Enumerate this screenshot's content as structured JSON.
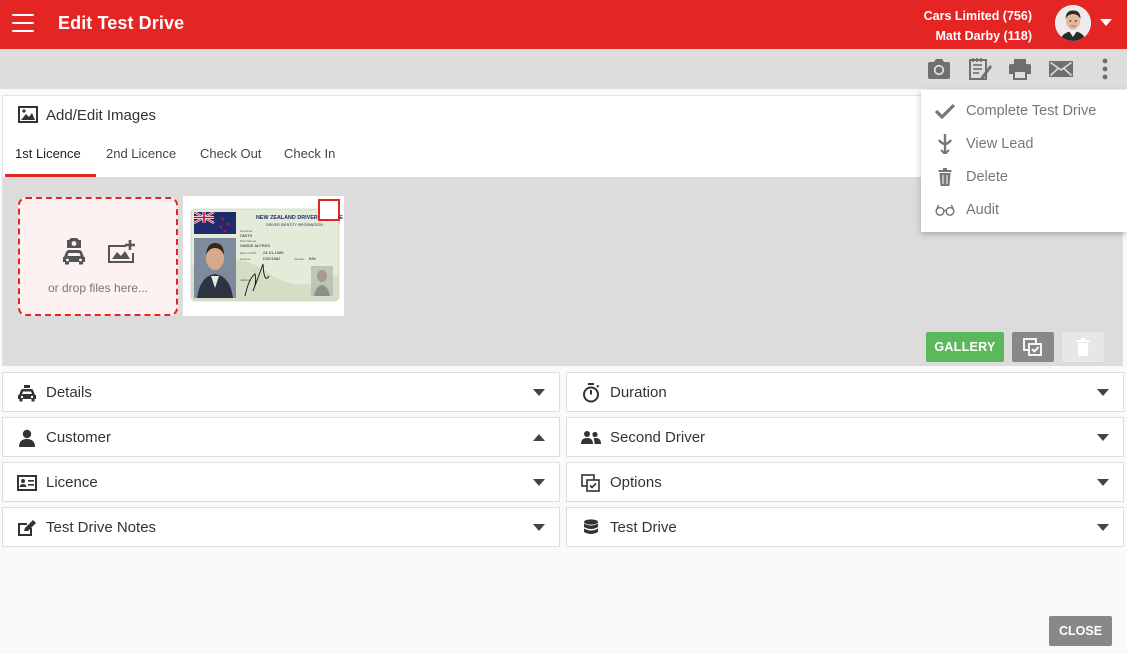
{
  "header": {
    "title": "Edit Test Drive",
    "company": "Cars Limited (756)",
    "user": "Matt Darby (118)"
  },
  "toolbar": {
    "icons": [
      "camera-icon",
      "notes-icon",
      "print-icon",
      "email-icon",
      "more-vert-icon"
    ]
  },
  "menu": {
    "items": [
      {
        "label": "Complete Test Drive",
        "icon": "check-icon"
      },
      {
        "label": "View Lead",
        "icon": "lead-icon"
      },
      {
        "label": "Delete",
        "icon": "trash-icon"
      },
      {
        "label": "Audit",
        "icon": "glasses-icon"
      }
    ]
  },
  "images": {
    "title": "Add/Edit Images",
    "tabs": [
      "1st Licence",
      "2nd Licence",
      "Check Out",
      "Check In"
    ],
    "active_tab": "1st Licence",
    "dropzone_text": "or drop files here...",
    "thumbnail": {
      "heading": "NEW ZEALAND DRIVER LICENCE",
      "subheading": "DRIVER IDENTITY INFORMATION",
      "surname_label": "Surname",
      "surname": "SMITH",
      "first_names_label": "First Names",
      "first_names": "SABDE ALFRED",
      "dob_label": "Date of birth",
      "dob": "24-01-1985",
      "licence_label": "Licence",
      "licence_no": "DI921582",
      "version_label": "Version",
      "version": "BIN",
      "address_label": "Address"
    },
    "gallery_label": "GALLERY"
  },
  "panels": {
    "left": [
      {
        "label": "Details",
        "icon": "car-icon",
        "expanded": false
      },
      {
        "label": "Customer",
        "icon": "person-icon",
        "expanded": true
      },
      {
        "label": "Licence",
        "icon": "id-card-icon",
        "expanded": false
      },
      {
        "label": "Test Drive Notes",
        "icon": "edit-note-icon",
        "expanded": false
      }
    ],
    "right": [
      {
        "label": "Duration",
        "icon": "stopwatch-icon",
        "expanded": false
      },
      {
        "label": "Second Driver",
        "icon": "people-icon",
        "expanded": false
      },
      {
        "label": "Options",
        "icon": "options-icon",
        "expanded": false
      },
      {
        "label": "Test Drive",
        "icon": "database-icon",
        "expanded": false
      }
    ]
  },
  "footer": {
    "close_label": "CLOSE"
  },
  "colors": {
    "brand_red": "#e52424",
    "toolbar_bg": "#dddddd",
    "gallery_green": "#5cb85c",
    "button_gray": "#888888"
  }
}
